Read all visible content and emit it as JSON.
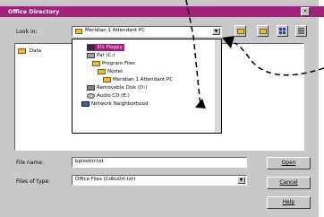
{
  "window": {
    "title": "Office Directory",
    "close_glyph": "×"
  },
  "look_in": {
    "label": "Look in:",
    "value": "Meridian 1 Attendant PC"
  },
  "toolbar": {
    "icons": [
      "up-folder-icon",
      "new-folder-icon",
      "list-view-icon",
      "details-view-icon"
    ]
  },
  "file_list": [
    {
      "name": "Data"
    }
  ],
  "dropdown": {
    "items": [
      {
        "label": "3½ Floppy (A:)",
        "icon": "floppy-icon",
        "selected": true
      },
      {
        "label": "Pat (C:)",
        "icon": "drive-icon"
      },
      {
        "label": "Program Files",
        "icon": "folder-icon"
      },
      {
        "label": "Nortel",
        "icon": "folder-icon"
      },
      {
        "label": "Meridian 1 Attendant PC",
        "icon": "folder-icon"
      },
      {
        "label": "Removable Disk (D:)",
        "icon": "removable-disk-icon"
      },
      {
        "label": "Audio CD (E:)",
        "icon": "cd-icon"
      },
      {
        "label": "Network Neighborhood",
        "icon": "network-icon"
      }
    ]
  },
  "file_name": {
    "label": "File name:",
    "value": "bplooktr.txt"
  },
  "files_of_type": {
    "label": "Files of type:",
    "value": "Office Files (Cdbu0rt.txt)"
  },
  "buttons": {
    "open": "Open",
    "cancel": "Cancel",
    "help": "Help"
  },
  "colors": {
    "title_bar": "#a0207c",
    "selection": "#a0207c",
    "dialog_bg": "#c8c8c8"
  }
}
